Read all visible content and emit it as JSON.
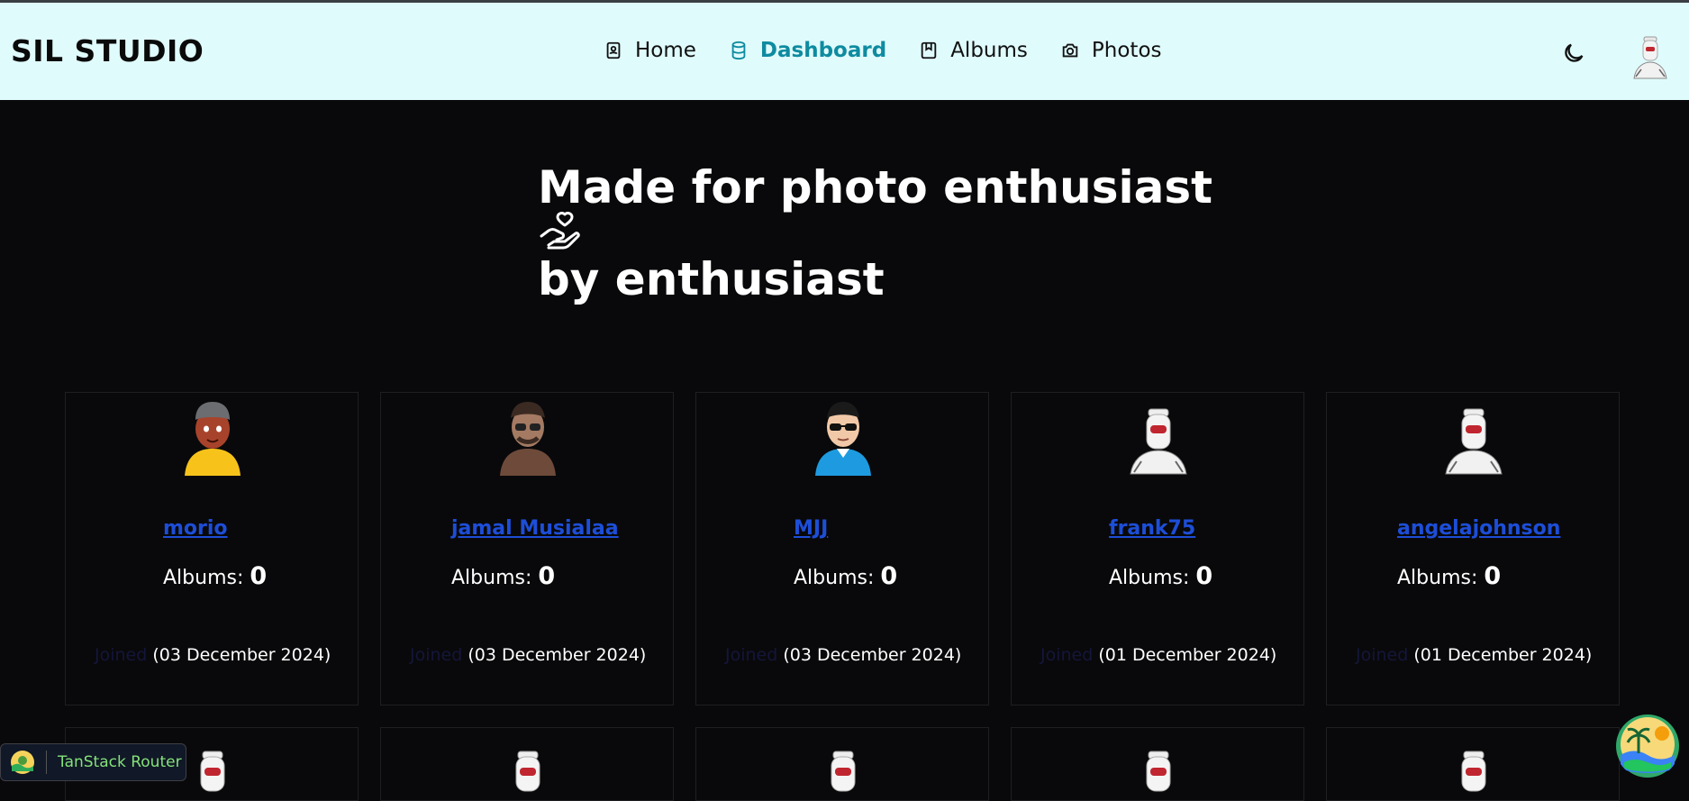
{
  "brand": "SIL STUDIO",
  "nav": [
    {
      "label": "Home",
      "icon": "contact-book-icon"
    },
    {
      "label": "Dashboard",
      "icon": "database-icon",
      "active": true
    },
    {
      "label": "Albums",
      "icon": "bookmark-icon"
    },
    {
      "label": "Photos",
      "icon": "camera-icon"
    }
  ],
  "hero": {
    "line1": "Made for photo enthusiast",
    "line2": "by enthusiast"
  },
  "colors": {
    "header_bg": "#e0fbfc",
    "active_nav": "#0e8ba0",
    "link": "#1d4ed8",
    "page_bg": "#09090b"
  },
  "users": [
    {
      "name": "morio",
      "albums_label": "Albums:",
      "albums": "0",
      "joined_label": "Joined",
      "joined": "(03 December 2024)",
      "avatar": "avatar-boy-yellow"
    },
    {
      "name": "jamal Musialaa",
      "albums_label": "Albums:",
      "albums": "0",
      "joined_label": "Joined",
      "joined": "(03 December 2024)",
      "avatar": "avatar-man-glasses"
    },
    {
      "name": "MJJ",
      "albums_label": "Albums:",
      "albums": "0",
      "joined_label": "Joined",
      "joined": "(03 December 2024)",
      "avatar": "avatar-man-sunglasses"
    },
    {
      "name": "frank75",
      "albums_label": "Albums:",
      "albums": "0",
      "joined_label": "Joined",
      "joined": "(01 December 2024)",
      "avatar": "avatar-robot"
    },
    {
      "name": "angelajohnson",
      "albums_label": "Albums:",
      "albums": "0",
      "joined_label": "Joined",
      "joined": "(01 December 2024)",
      "avatar": "avatar-robot"
    }
  ],
  "devtools": {
    "label": "TanStack Router"
  }
}
